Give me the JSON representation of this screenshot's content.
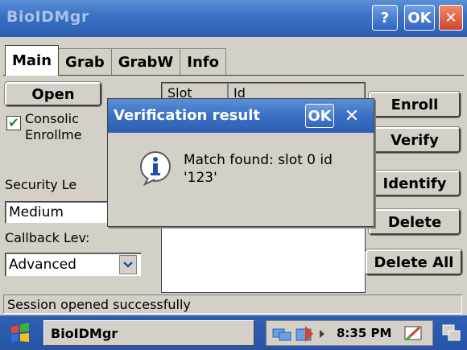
{
  "window": {
    "title": "BioIDMgr",
    "help_label": "?",
    "ok_label": "OK",
    "close_label": "✕"
  },
  "tabs": [
    {
      "label": "Main",
      "active": true
    },
    {
      "label": "Grab",
      "active": false
    },
    {
      "label": "GrabW",
      "active": false
    },
    {
      "label": "Info",
      "active": false
    }
  ],
  "main": {
    "open_label": "Open",
    "consolidated_label_1": "Consolic",
    "consolidated_label_2": "Enrollme",
    "consolidated_checked": true,
    "security_level_label": "Security Le",
    "security_level_value": "Medium",
    "callback_level_label": "Callback Lev:",
    "callback_level_value": "Advanced",
    "list_headers": [
      "Slot",
      "Id"
    ],
    "buttons": {
      "enroll": "Enroll",
      "verify": "Verify",
      "identify": "Identify",
      "delete": "Delete",
      "delete_all": "Delete All"
    }
  },
  "dialog": {
    "title": "Verification result",
    "ok_label": "OK",
    "close_label": "✕",
    "message_line1": "Match found: slot 0 id",
    "message_line2": "'123'",
    "icon": "info-icon"
  },
  "status": {
    "text": "Session opened successfully"
  },
  "taskbar": {
    "app_label": "BioIDMgr",
    "clock": "8:35 PM"
  },
  "colors": {
    "titlebar": "#3a70c4",
    "dialog_face": "#d4d0c8",
    "close_red": "#d0462a",
    "check_green": "#1a8a1a"
  }
}
